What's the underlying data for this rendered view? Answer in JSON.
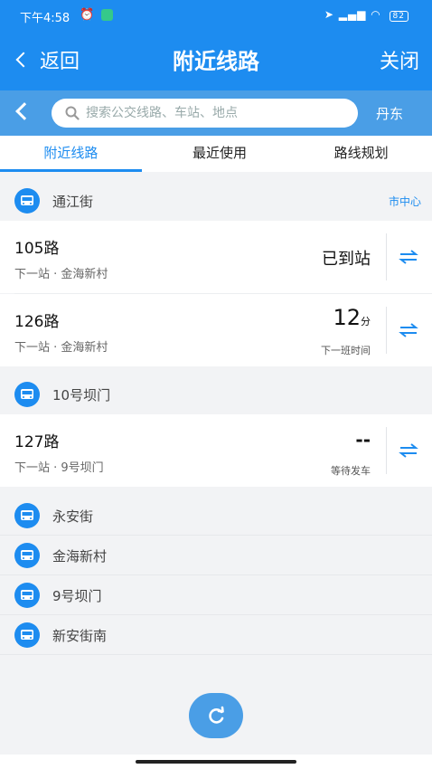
{
  "status": {
    "time": "下午4:58",
    "battery": "82"
  },
  "nav": {
    "back_label": "返回",
    "title": "附近线路",
    "close_label": "关闭"
  },
  "search": {
    "placeholder": "搜索公交线路、车站、地点",
    "city": "丹东"
  },
  "tabs": [
    {
      "label": "附近线路",
      "active": true
    },
    {
      "label": "最近使用",
      "active": false
    },
    {
      "label": "路线规划",
      "active": false
    }
  ],
  "stops": [
    {
      "name": "通江街",
      "direction": "市中心",
      "routes": [
        {
          "name": "105路",
          "next": "下一站 · 金海新村",
          "status": "已到站"
        },
        {
          "name": "126路",
          "next": "下一站 · 金海新村",
          "minutes": "12",
          "unit": "分",
          "sub": "下一班时间"
        }
      ]
    },
    {
      "name": "10号坝门",
      "routes": [
        {
          "name": "127路",
          "next": "下一站 · 9号坝门",
          "status": "--",
          "sub": "等待发车"
        }
      ]
    }
  ],
  "other_stops": [
    "永安街",
    "金海新村",
    "9号坝门",
    "新安街南"
  ],
  "colors": {
    "primary": "#1d8cf0",
    "search_bar": "#4a9ee6",
    "background": "#f2f3f5"
  },
  "icons": {
    "bus": "bus-icon",
    "swap": "swap-arrows-icon",
    "refresh": "refresh-icon",
    "search": "search-icon"
  }
}
